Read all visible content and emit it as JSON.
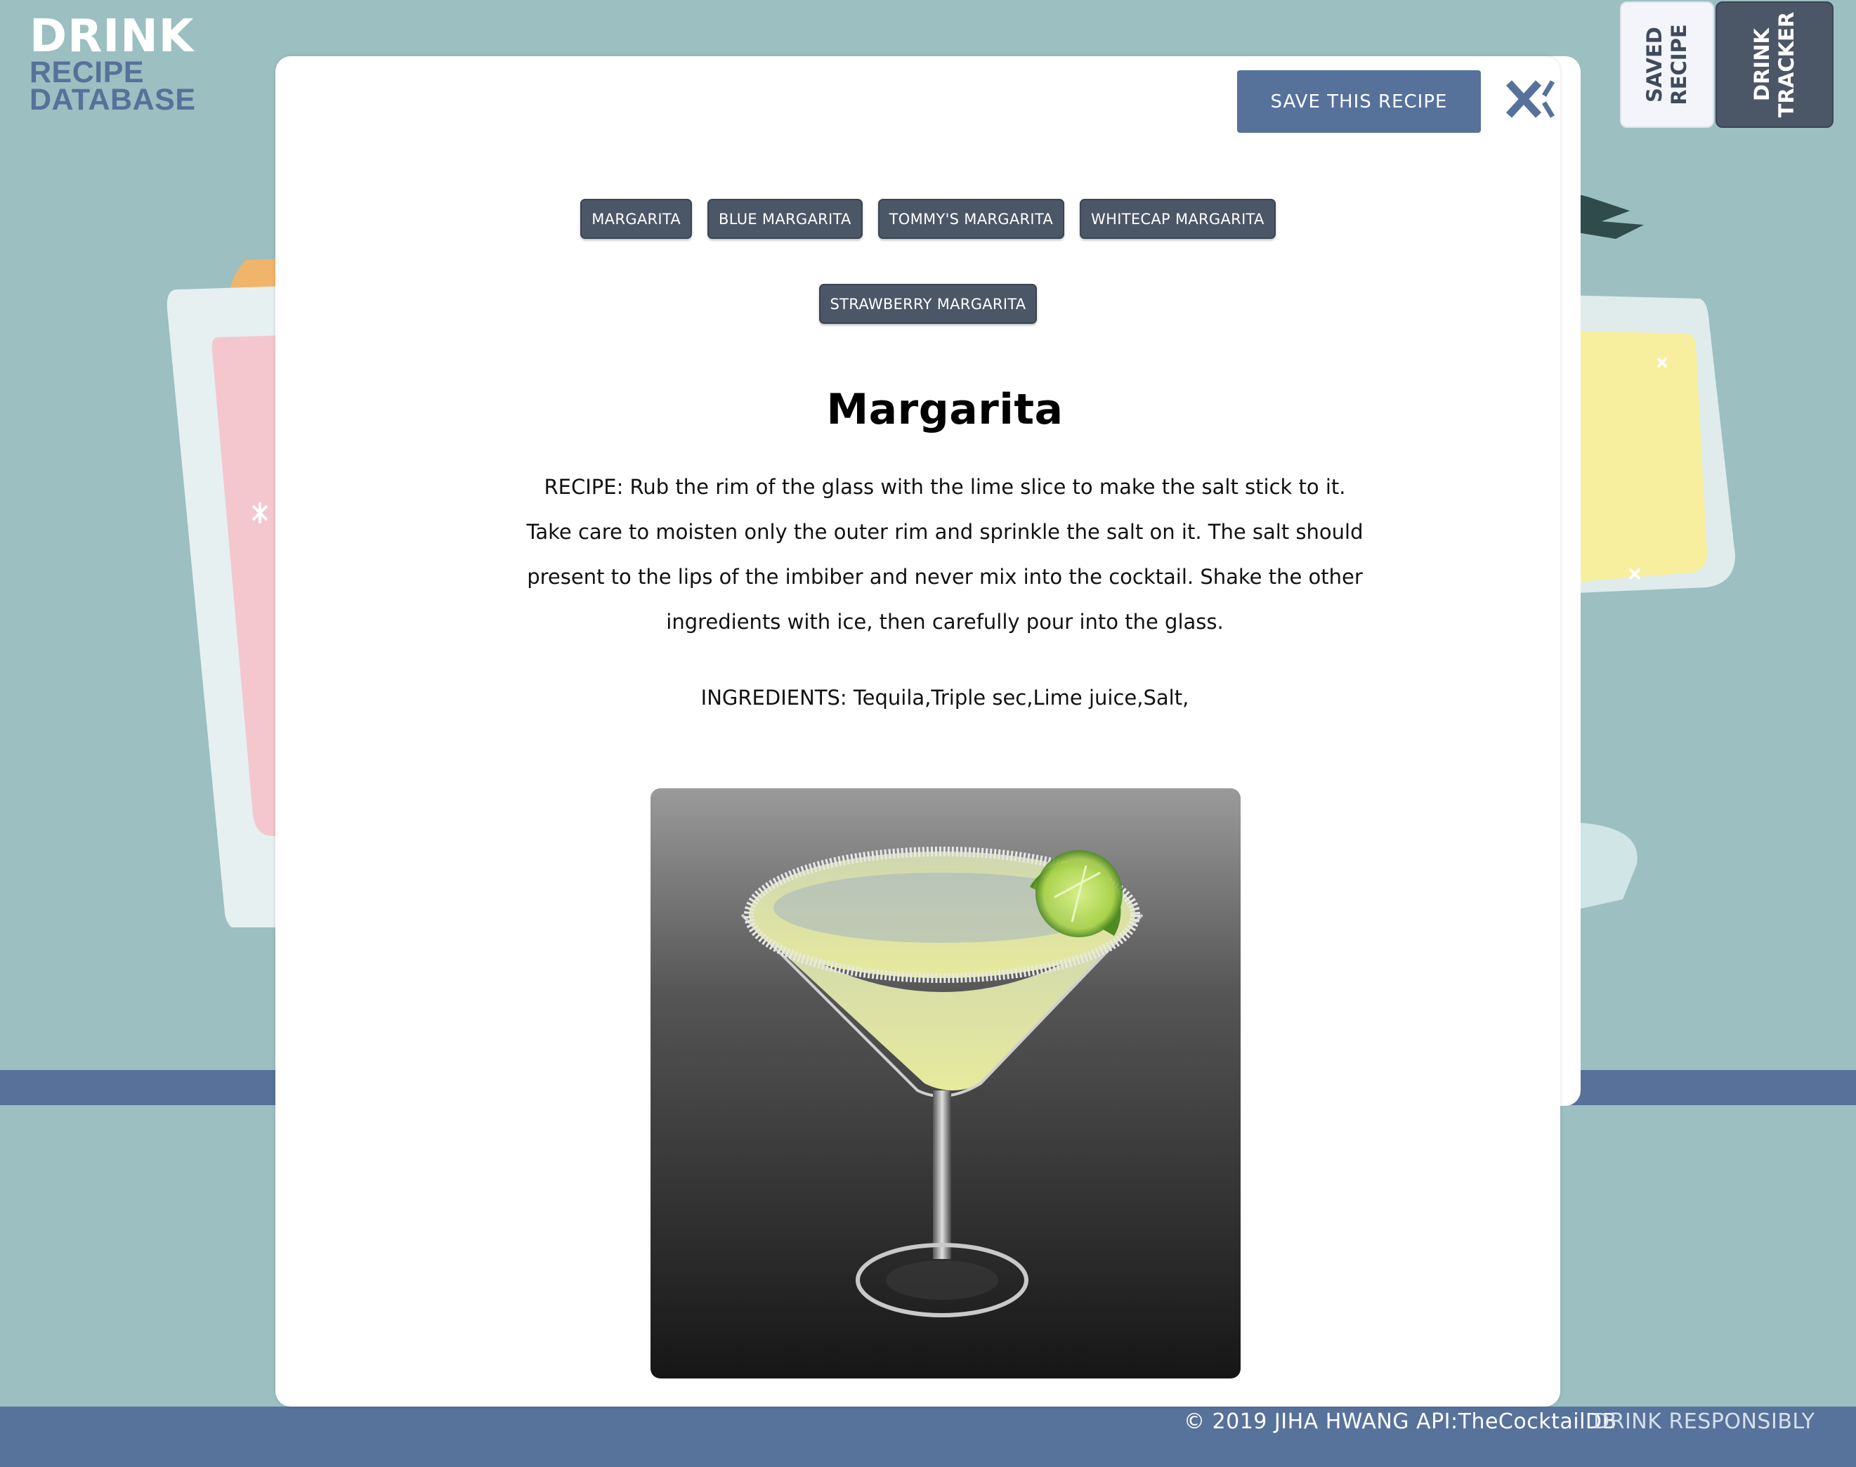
{
  "logo": {
    "line1": "DRINK",
    "line2": "RECIPE",
    "line3": "DATABASE"
  },
  "side_tabs": [
    {
      "label_line1": "SAVED",
      "label_line2": "RECIPE"
    },
    {
      "label_line1": "DRINK",
      "label_line2": "TRACKER"
    }
  ],
  "modal": {
    "save_label": "SAVE THIS RECIPE",
    "close_icon": "close-x-icon",
    "variants_row1": [
      "MARGARITA",
      "BLUE MARGARITA",
      "TOMMY'S MARGARITA",
      "WHITECAP MARGARITA"
    ],
    "variants_row2": [
      "STRAWBERRY MARGARITA"
    ],
    "title": "Margarita",
    "recipe": "RECIPE: Rub the rim of the glass with the lime slice to make the salt stick to it. Take care to moisten only the outer rim and sprinkle the salt on it. The salt should present to the lips of the imbiber and never mix into the cocktail. Shake the other ingredients with ice, then carefully pour into the glass.",
    "ingredients": "INGREDIENTS: Tequila,Triple sec,Lime juice,Salt,",
    "image_icon": "margarita-glass-photo"
  },
  "footer": {
    "copyright": "© 2019 JIHA HWANG  API:TheCocktailDB",
    "responsibly": "DRINK RESPONSIBLY"
  },
  "colors": {
    "background": "#9cbfc1",
    "accent_blue": "#56729b",
    "dark_button": "#4b5666",
    "modal": "#ffffff"
  }
}
